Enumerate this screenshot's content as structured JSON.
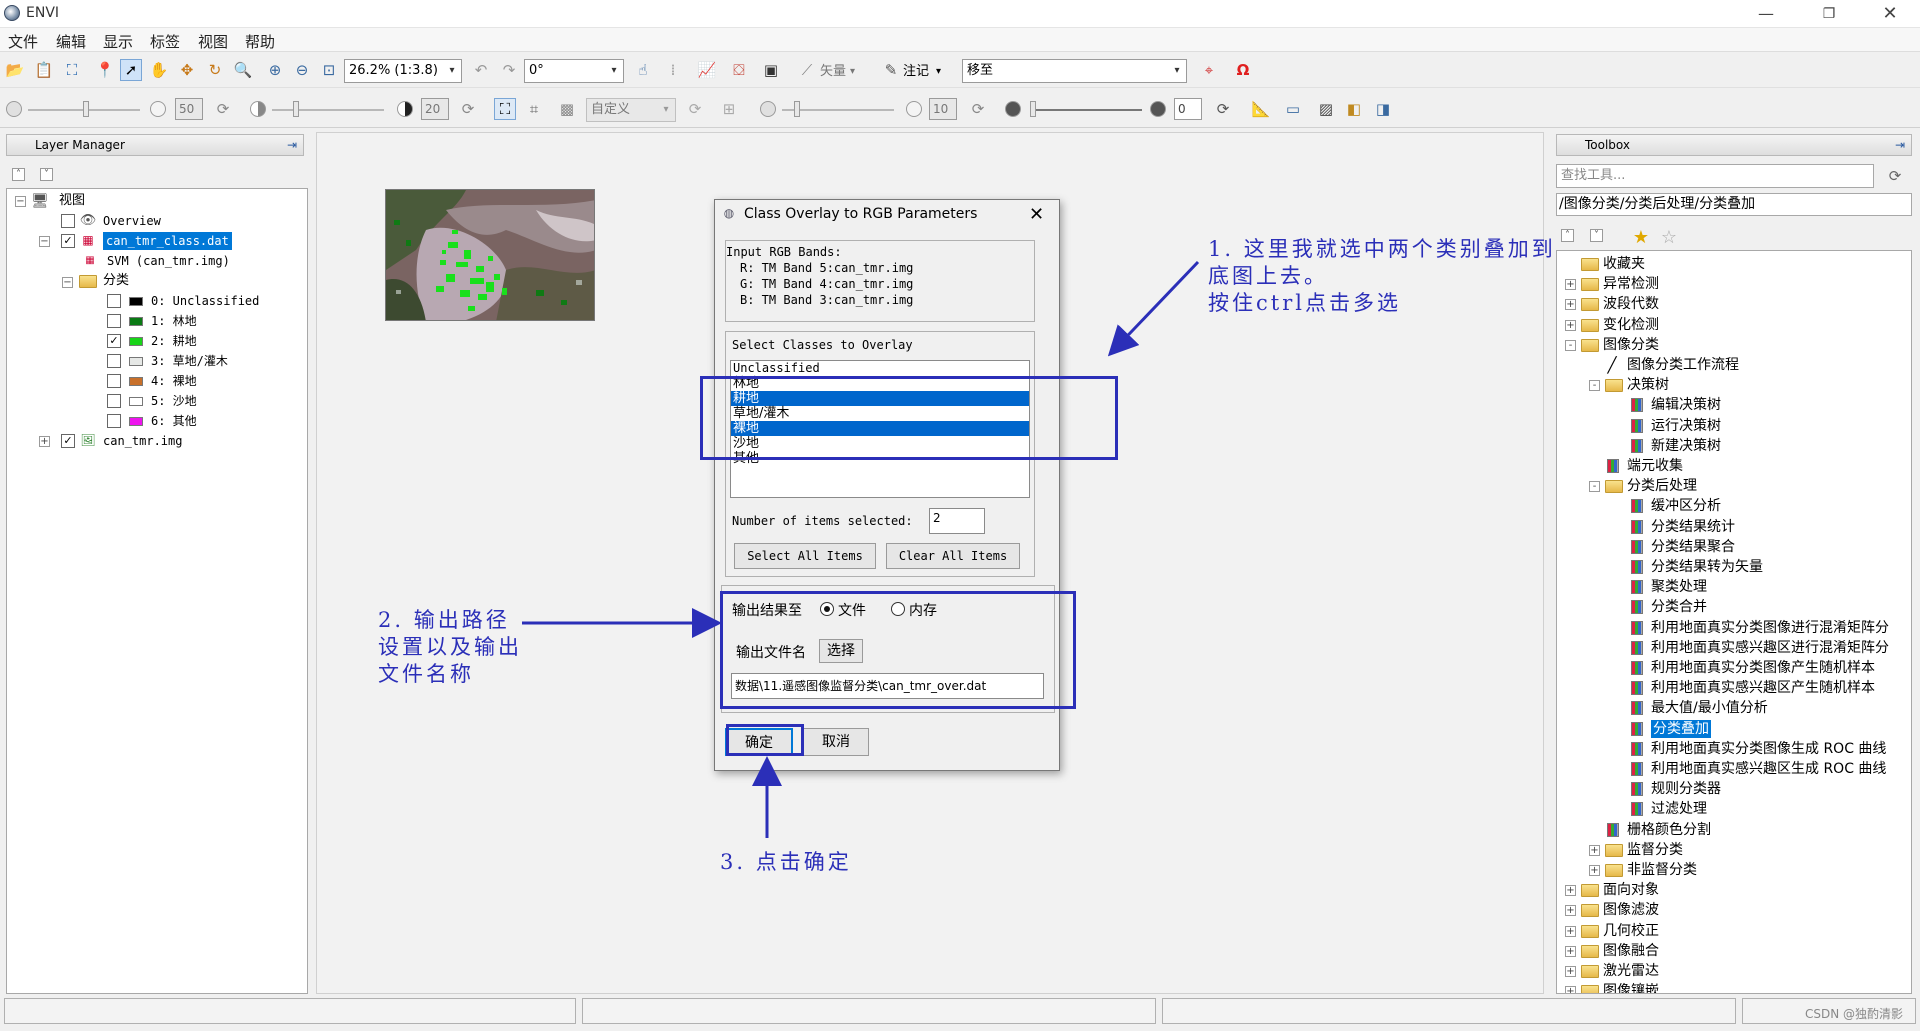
{
  "window": {
    "title": "ENVI"
  },
  "menu": {
    "items": [
      "文件",
      "编辑",
      "显示",
      "标签",
      "视图",
      "帮助"
    ]
  },
  "toolbar1": {
    "zoom": "26.2% (1:3.8)",
    "rotation": "0°",
    "vector_label": "矢量",
    "annotate_label": "注记",
    "goto": "移至"
  },
  "toolbar2": {
    "brightness": "50",
    "contrast": "20",
    "stretch": "自定义",
    "sharpen": "10",
    "transparency": "0"
  },
  "layer_manager": {
    "title": "Layer Manager",
    "view_label": "视图",
    "overview": "Overview",
    "class_file": "can_tmr_class.dat",
    "svm": "SVM (can_tmr.img)",
    "classes_label": "分类",
    "classes": [
      {
        "label": "0: Unclassified",
        "checked": false,
        "color": "#000000"
      },
      {
        "label": "1: 林地",
        "checked": false,
        "color": "#0a7a14"
      },
      {
        "label": "2: 耕地",
        "checked": true,
        "color": "#18d418"
      },
      {
        "label": "3: 草地/灌木",
        "checked": false,
        "color": "#e6e8e6"
      },
      {
        "label": "4: 裸地",
        "checked": false,
        "color": "#c8702a"
      },
      {
        "label": "5: 沙地",
        "checked": false,
        "color": "#ffffff"
      },
      {
        "label": "6: 其他",
        "checked": false,
        "color": "#ee14ee"
      }
    ],
    "image_file": "can_tmr.img"
  },
  "dialog": {
    "title": "Class Overlay to RGB Parameters",
    "input_header": "Input RGB Bands:",
    "bands": [
      "R: TM Band 5:can_tmr.img",
      "G: TM Band 4:can_tmr.img",
      "B: TM Band 3:can_tmr.img"
    ],
    "select_header": "Select Classes to Overlay",
    "class_list": [
      {
        "label": "Unclassified",
        "selected": false
      },
      {
        "label": "林地",
        "selected": false
      },
      {
        "label": "耕地",
        "selected": true
      },
      {
        "label": "草地/灌木",
        "selected": false
      },
      {
        "label": "裸地",
        "selected": true
      },
      {
        "label": "沙地",
        "selected": false
      },
      {
        "label": "其他",
        "selected": false
      }
    ],
    "count_label": "Number of items selected:",
    "count": "2",
    "select_all": "Select All Items",
    "clear_all": "Clear All Items",
    "output_to": "输出结果至",
    "opt_file": "文件",
    "opt_memory": "内存",
    "output_name_label": "输出文件名",
    "choose": "选择",
    "output_path": "数据\\11.遥感图像监督分类\\can_tmr_over.dat",
    "ok": "确定",
    "cancel": "取消"
  },
  "annotations": {
    "note1": [
      "1. 这里我就选中两个类别叠加到",
      "底图上去。",
      "按住ctrl点击多选"
    ],
    "note2": [
      "2. 输出路径",
      "设置以及输出",
      "文件名称"
    ],
    "note3": "3. 点击确定"
  },
  "toolbox": {
    "title": "Toolbox",
    "search_placeholder": "查找工具...",
    "path": "/图像分类/分类后处理/分类叠加",
    "items": [
      {
        "label": "收藏夹",
        "level": 0,
        "kind": "folder",
        "exp": ""
      },
      {
        "label": "异常检测",
        "level": 0,
        "kind": "folder",
        "exp": "+"
      },
      {
        "label": "波段代数",
        "level": 0,
        "kind": "folder",
        "exp": "+"
      },
      {
        "label": "变化检测",
        "level": 0,
        "kind": "folder",
        "exp": "+"
      },
      {
        "label": "图像分类",
        "level": 0,
        "kind": "folder",
        "exp": "-"
      },
      {
        "label": "图像分类工作流程",
        "level": 1,
        "kind": "wand",
        "exp": ""
      },
      {
        "label": "决策树",
        "level": 1,
        "kind": "folder",
        "exp": "-"
      },
      {
        "label": "编辑决策树",
        "level": 2,
        "kind": "tool",
        "exp": ""
      },
      {
        "label": "运行决策树",
        "level": 2,
        "kind": "tool",
        "exp": ""
      },
      {
        "label": "新建决策树",
        "level": 2,
        "kind": "tool",
        "exp": ""
      },
      {
        "label": "端元收集",
        "level": 1,
        "kind": "tool",
        "exp": ""
      },
      {
        "label": "分类后处理",
        "level": 1,
        "kind": "folder",
        "exp": "-"
      },
      {
        "label": "缓冲区分析",
        "level": 2,
        "kind": "tool",
        "exp": ""
      },
      {
        "label": "分类结果统计",
        "level": 2,
        "kind": "tool",
        "exp": ""
      },
      {
        "label": "分类结果聚合",
        "level": 2,
        "kind": "tool",
        "exp": ""
      },
      {
        "label": "分类结果转为矢量",
        "level": 2,
        "kind": "tool",
        "exp": ""
      },
      {
        "label": "聚类处理",
        "level": 2,
        "kind": "tool",
        "exp": ""
      },
      {
        "label": "分类合并",
        "level": 2,
        "kind": "tool",
        "exp": ""
      },
      {
        "label": "利用地面真实分类图像进行混淆矩阵分",
        "level": 2,
        "kind": "tool",
        "exp": ""
      },
      {
        "label": "利用地面真实感兴趣区进行混淆矩阵分",
        "level": 2,
        "kind": "tool",
        "exp": ""
      },
      {
        "label": "利用地面真实分类图像产生随机样本",
        "level": 2,
        "kind": "tool",
        "exp": ""
      },
      {
        "label": "利用地面真实感兴趣区产生随机样本",
        "level": 2,
        "kind": "tool",
        "exp": ""
      },
      {
        "label": "最大值/最小值分析",
        "level": 2,
        "kind": "tool",
        "exp": ""
      },
      {
        "label": "分类叠加",
        "level": 2,
        "kind": "tool",
        "exp": "",
        "selected": true
      },
      {
        "label": "利用地面真实分类图像生成 ROC 曲线",
        "level": 2,
        "kind": "tool",
        "exp": ""
      },
      {
        "label": "利用地面真实感兴趣区生成 ROC 曲线",
        "level": 2,
        "kind": "tool",
        "exp": ""
      },
      {
        "label": "规则分类器",
        "level": 2,
        "kind": "tool",
        "exp": ""
      },
      {
        "label": "过滤处理",
        "level": 2,
        "kind": "tool",
        "exp": ""
      },
      {
        "label": "栅格颜色分割",
        "level": 1,
        "kind": "tool",
        "exp": ""
      },
      {
        "label": "监督分类",
        "level": 1,
        "kind": "folder",
        "exp": "+"
      },
      {
        "label": "非监督分类",
        "level": 1,
        "kind": "folder",
        "exp": "+"
      },
      {
        "label": "面向对象",
        "level": 0,
        "kind": "folder",
        "exp": "+"
      },
      {
        "label": "图像滤波",
        "level": 0,
        "kind": "folder",
        "exp": "+"
      },
      {
        "label": "几何校正",
        "level": 0,
        "kind": "folder",
        "exp": "+"
      },
      {
        "label": "图像融合",
        "level": 0,
        "kind": "folder",
        "exp": "+"
      },
      {
        "label": "激光雷达",
        "level": 0,
        "kind": "folder",
        "exp": "+"
      },
      {
        "label": "图像镶嵌",
        "level": 0,
        "kind": "folder",
        "exp": "+"
      }
    ]
  },
  "watermark": "CSDN @独酌清影",
  "colors": {
    "accent": "#0078d7",
    "annotation": "#2b2fb8",
    "selection": "#0066cc"
  }
}
